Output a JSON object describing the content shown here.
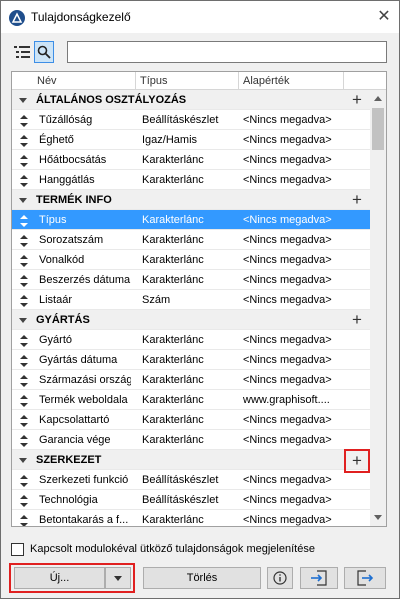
{
  "window": {
    "title": "Tulajdonságkezelő"
  },
  "toolbar": {
    "search_value": ""
  },
  "columns": [
    "Név",
    "Típus",
    "Alapérték"
  ],
  "groups": [
    {
      "label": "ÁLTALÁNOS OSZTÁLYOZÁS",
      "highlighted": false,
      "items": [
        {
          "name": "Tűzállóság",
          "type": "Beállításkészlet",
          "default": "<Nincs megadva>"
        },
        {
          "name": "Éghető",
          "type": "Igaz/Hamis",
          "default": "<Nincs megadva>"
        },
        {
          "name": "Hőátbocsátás",
          "type": "Karakterlánc",
          "default": "<Nincs megadva>"
        },
        {
          "name": "Hanggátlás",
          "type": "Karakterlánc",
          "default": "<Nincs megadva>"
        }
      ]
    },
    {
      "label": "TERMÉK INFO",
      "highlighted": false,
      "items": [
        {
          "name": "Típus",
          "type": "Karakterlánc",
          "default": "<Nincs megadva>",
          "selected": true
        },
        {
          "name": "Sorozatszám",
          "type": "Karakterlánc",
          "default": "<Nincs megadva>"
        },
        {
          "name": "Vonalkód",
          "type": "Karakterlánc",
          "default": "<Nincs megadva>"
        },
        {
          "name": "Beszerzés dátuma",
          "type": "Karakterlánc",
          "default": "<Nincs megadva>"
        },
        {
          "name": "Listaár",
          "type": "Szám",
          "default": "<Nincs megadva>"
        }
      ]
    },
    {
      "label": "GYÁRTÁS",
      "highlighted": false,
      "items": [
        {
          "name": "Gyártó",
          "type": "Karakterlánc",
          "default": "<Nincs megadva>"
        },
        {
          "name": "Gyártás dátuma",
          "type": "Karakterlánc",
          "default": "<Nincs megadva>"
        },
        {
          "name": "Származási ország",
          "type": "Karakterlánc",
          "default": "<Nincs megadva>"
        },
        {
          "name": "Termék weboldala",
          "type": "Karakterlánc",
          "default": "www.graphisoft...."
        },
        {
          "name": "Kapcsolattartó",
          "type": "Karakterlánc",
          "default": "<Nincs megadva>"
        },
        {
          "name": "Garancia vége",
          "type": "Karakterlánc",
          "default": "<Nincs megadva>"
        }
      ]
    },
    {
      "label": "SZERKEZET",
      "highlighted": true,
      "items": [
        {
          "name": "Szerkezeti funkció",
          "type": "Beállításkészlet",
          "default": "<Nincs megadva>"
        },
        {
          "name": "Technológia",
          "type": "Beállításkészlet",
          "default": "<Nincs megadva>"
        },
        {
          "name": "Betontakarás a f...",
          "type": "Karakterlánc",
          "default": "<Nincs megadva>"
        }
      ]
    }
  ],
  "footer": {
    "checkbox_label": "Kapcsolt modulokéval ütköző tulajdonságok megjelenítése",
    "checkbox_checked": false,
    "new_label": "Új...",
    "delete_label": "Törlés"
  },
  "colors": {
    "selection": "#3399ff",
    "highlight_outline": "#e02020",
    "search_active": "#cce4f7"
  }
}
